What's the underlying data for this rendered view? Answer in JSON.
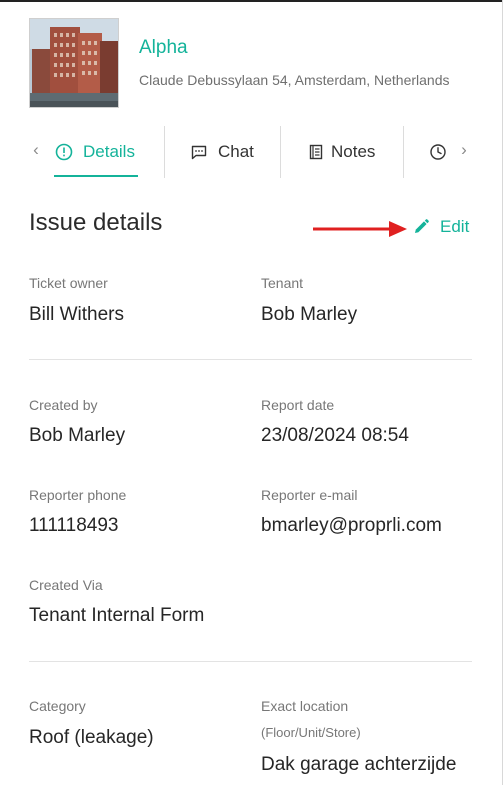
{
  "property": {
    "name": "Alpha",
    "address": "Claude Debussylaan 54, Amsterdam, Netherlands"
  },
  "tabs": [
    {
      "label": "Details",
      "icon": "info-circle-icon",
      "active": true
    },
    {
      "label": "Chat",
      "icon": "chat-bubble-icon",
      "active": false
    },
    {
      "label": "Notes",
      "icon": "notes-icon",
      "active": false
    },
    {
      "label": "",
      "icon": "clock-icon",
      "active": false
    }
  ],
  "section": {
    "title": "Issue details",
    "edit_label": "Edit"
  },
  "fields": {
    "ticket_owner": {
      "label": "Ticket owner",
      "value": "Bill Withers"
    },
    "tenant": {
      "label": "Tenant",
      "value": "Bob Marley"
    },
    "created_by": {
      "label": "Created by",
      "value": "Bob Marley"
    },
    "report_date": {
      "label": "Report date",
      "value": "23/08/2024 08:54"
    },
    "reporter_phone": {
      "label": "Reporter phone",
      "value": "111118493"
    },
    "reporter_email": {
      "label": "Reporter e-mail",
      "value": "bmarley@proprli.com"
    },
    "created_via": {
      "label": "Created Via",
      "value": "Tenant Internal Form"
    },
    "category": {
      "label": "Category",
      "value": "Roof (leakage)"
    },
    "exact_location": {
      "label": "Exact location",
      "sublabel": "(Floor/Unit/Store)",
      "value": "Dak garage achterzijde"
    }
  },
  "colors": {
    "accent": "#14b39a",
    "annotation_arrow": "#e02020"
  }
}
